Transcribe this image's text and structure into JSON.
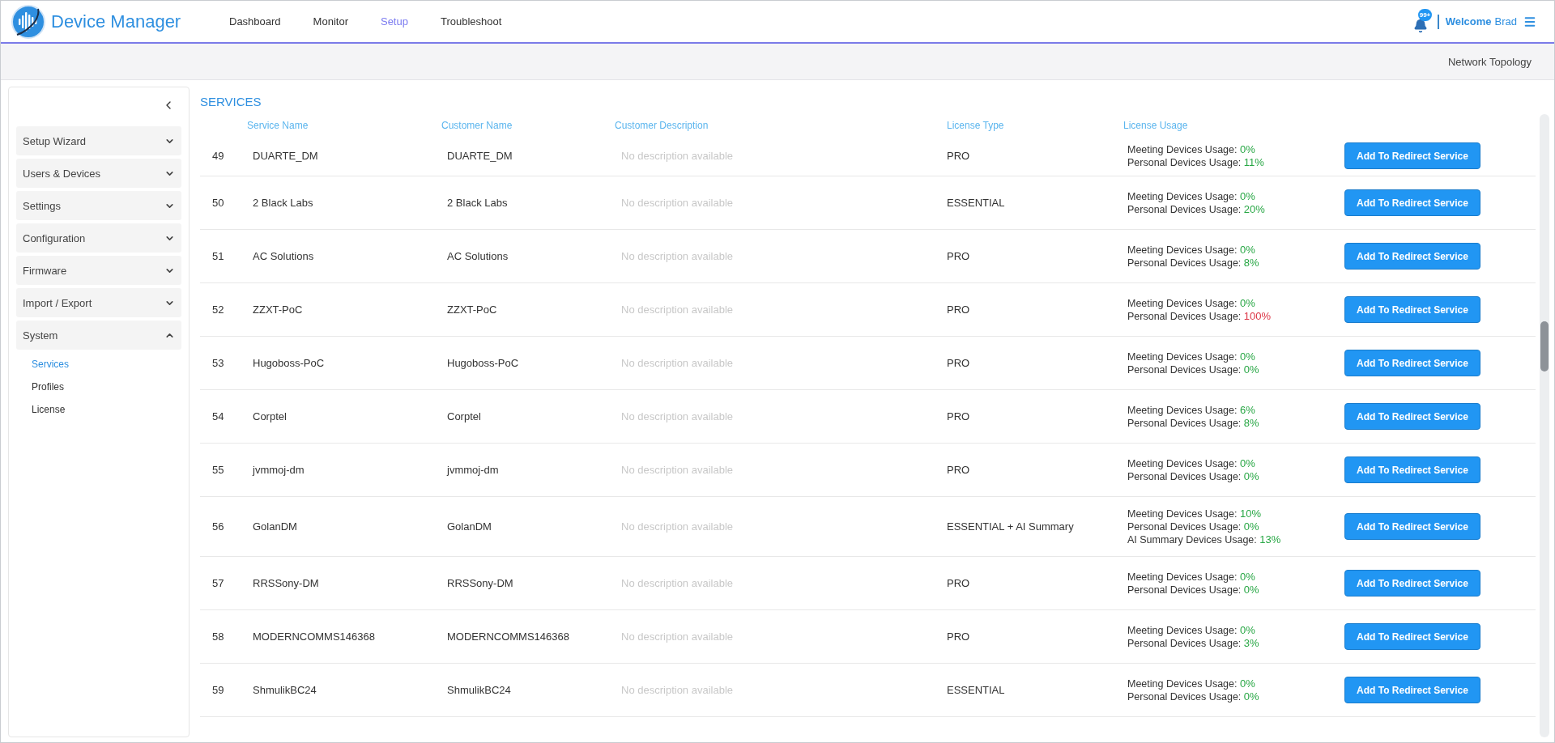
{
  "header": {
    "app_title": "Device Manager",
    "nav": [
      {
        "label": "Dashboard",
        "selected": false
      },
      {
        "label": "Monitor",
        "selected": false
      },
      {
        "label": "Setup",
        "selected": true
      },
      {
        "label": "Troubleshoot",
        "selected": false
      }
    ],
    "notification_badge": "99+",
    "welcome": "Welcome",
    "user": "Brad"
  },
  "subheader": {
    "link": "Network Topology"
  },
  "sidebar": {
    "items": [
      {
        "label": "Setup Wizard",
        "expanded": false
      },
      {
        "label": "Users & Devices",
        "expanded": false
      },
      {
        "label": "Settings",
        "expanded": false
      },
      {
        "label": "Configuration",
        "expanded": false
      },
      {
        "label": "Firmware",
        "expanded": false
      },
      {
        "label": "Import / Export",
        "expanded": false
      },
      {
        "label": "System",
        "expanded": true,
        "children": [
          {
            "label": "Services",
            "selected": true
          },
          {
            "label": "Profiles",
            "selected": false
          },
          {
            "label": "License",
            "selected": false
          }
        ]
      }
    ]
  },
  "services": {
    "title": "SERVICES",
    "columns": [
      "Service Name",
      "Customer Name",
      "Customer Description",
      "License Type",
      "License Usage"
    ],
    "rows": [
      {
        "number": "49",
        "service": "DUARTE_DM",
        "customer": "DUARTE_DM",
        "description": "No description available",
        "license": "PRO",
        "usage": [
          {
            "label": "Meeting Devices Usage:",
            "value": "0%",
            "alert": false
          },
          {
            "label": "Personal Devices Usage:",
            "value": "11%",
            "alert": false
          }
        ],
        "action": "Add To Redirect Service"
      },
      {
        "number": "50",
        "service": "2 Black Labs",
        "customer": "2 Black Labs",
        "description": "No description available",
        "license": "ESSENTIAL",
        "usage": [
          {
            "label": "Meeting Devices Usage:",
            "value": "0%",
            "alert": false
          },
          {
            "label": "Personal Devices Usage:",
            "value": "20%",
            "alert": false
          }
        ],
        "action": "Add To Redirect Service"
      },
      {
        "number": "51",
        "service": "AC Solutions",
        "customer": "AC Solutions",
        "description": "No description available",
        "license": "PRO",
        "usage": [
          {
            "label": "Meeting Devices Usage:",
            "value": "0%",
            "alert": false
          },
          {
            "label": "Personal Devices Usage:",
            "value": "8%",
            "alert": false
          }
        ],
        "action": "Add To Redirect Service"
      },
      {
        "number": "52",
        "service": "ZZXT-PoC",
        "customer": "ZZXT-PoC",
        "description": "No description available",
        "license": "PRO",
        "usage": [
          {
            "label": "Meeting Devices Usage:",
            "value": "0%",
            "alert": false
          },
          {
            "label": "Personal Devices Usage:",
            "value": "100%",
            "alert": true
          }
        ],
        "action": "Add To Redirect Service"
      },
      {
        "number": "53",
        "service": "Hugoboss-PoC",
        "customer": "Hugoboss-PoC",
        "description": "No description available",
        "license": "PRO",
        "usage": [
          {
            "label": "Meeting Devices Usage:",
            "value": "0%",
            "alert": false
          },
          {
            "label": "Personal Devices Usage:",
            "value": "0%",
            "alert": false
          }
        ],
        "action": "Add To Redirect Service"
      },
      {
        "number": "54",
        "service": "Corptel",
        "customer": "Corptel",
        "description": "No description available",
        "license": "PRO",
        "usage": [
          {
            "label": "Meeting Devices Usage:",
            "value": "6%",
            "alert": false
          },
          {
            "label": "Personal Devices Usage:",
            "value": "8%",
            "alert": false
          }
        ],
        "action": "Add To Redirect Service"
      },
      {
        "number": "55",
        "service": "jvmmoj-dm",
        "customer": "jvmmoj-dm",
        "description": "No description available",
        "license": "PRO",
        "usage": [
          {
            "label": "Meeting Devices Usage:",
            "value": "0%",
            "alert": false
          },
          {
            "label": "Personal Devices Usage:",
            "value": "0%",
            "alert": false
          }
        ],
        "action": "Add To Redirect Service"
      },
      {
        "number": "56",
        "service": "GolanDM",
        "customer": "GolanDM",
        "description": "No description available",
        "license": "ESSENTIAL + AI Summary",
        "usage": [
          {
            "label": "Meeting Devices Usage:",
            "value": "10%",
            "alert": false
          },
          {
            "label": "Personal Devices Usage:",
            "value": "0%",
            "alert": false
          },
          {
            "label": "AI Summary Devices Usage:",
            "value": "13%",
            "alert": false
          }
        ],
        "action": "Add To Redirect Service"
      },
      {
        "number": "57",
        "service": "RRSSony-DM",
        "customer": "RRSSony-DM",
        "description": "No description available",
        "license": "PRO",
        "usage": [
          {
            "label": "Meeting Devices Usage:",
            "value": "0%",
            "alert": false
          },
          {
            "label": "Personal Devices Usage:",
            "value": "0%",
            "alert": false
          }
        ],
        "action": "Add To Redirect Service"
      },
      {
        "number": "58",
        "service": "MODERNCOMMS146368",
        "customer": "MODERNCOMMS146368",
        "description": "No description available",
        "license": "PRO",
        "usage": [
          {
            "label": "Meeting Devices Usage:",
            "value": "0%",
            "alert": false
          },
          {
            "label": "Personal Devices Usage:",
            "value": "3%",
            "alert": false
          }
        ],
        "action": "Add To Redirect Service"
      },
      {
        "number": "59",
        "service": "ShmulikBC24",
        "customer": "ShmulikBC24",
        "description": "No description available",
        "license": "ESSENTIAL",
        "usage": [
          {
            "label": "Meeting Devices Usage:",
            "value": "0%",
            "alert": false
          },
          {
            "label": "Personal Devices Usage:",
            "value": "0%",
            "alert": false
          }
        ],
        "action": "Add To Redirect Service"
      }
    ]
  }
}
